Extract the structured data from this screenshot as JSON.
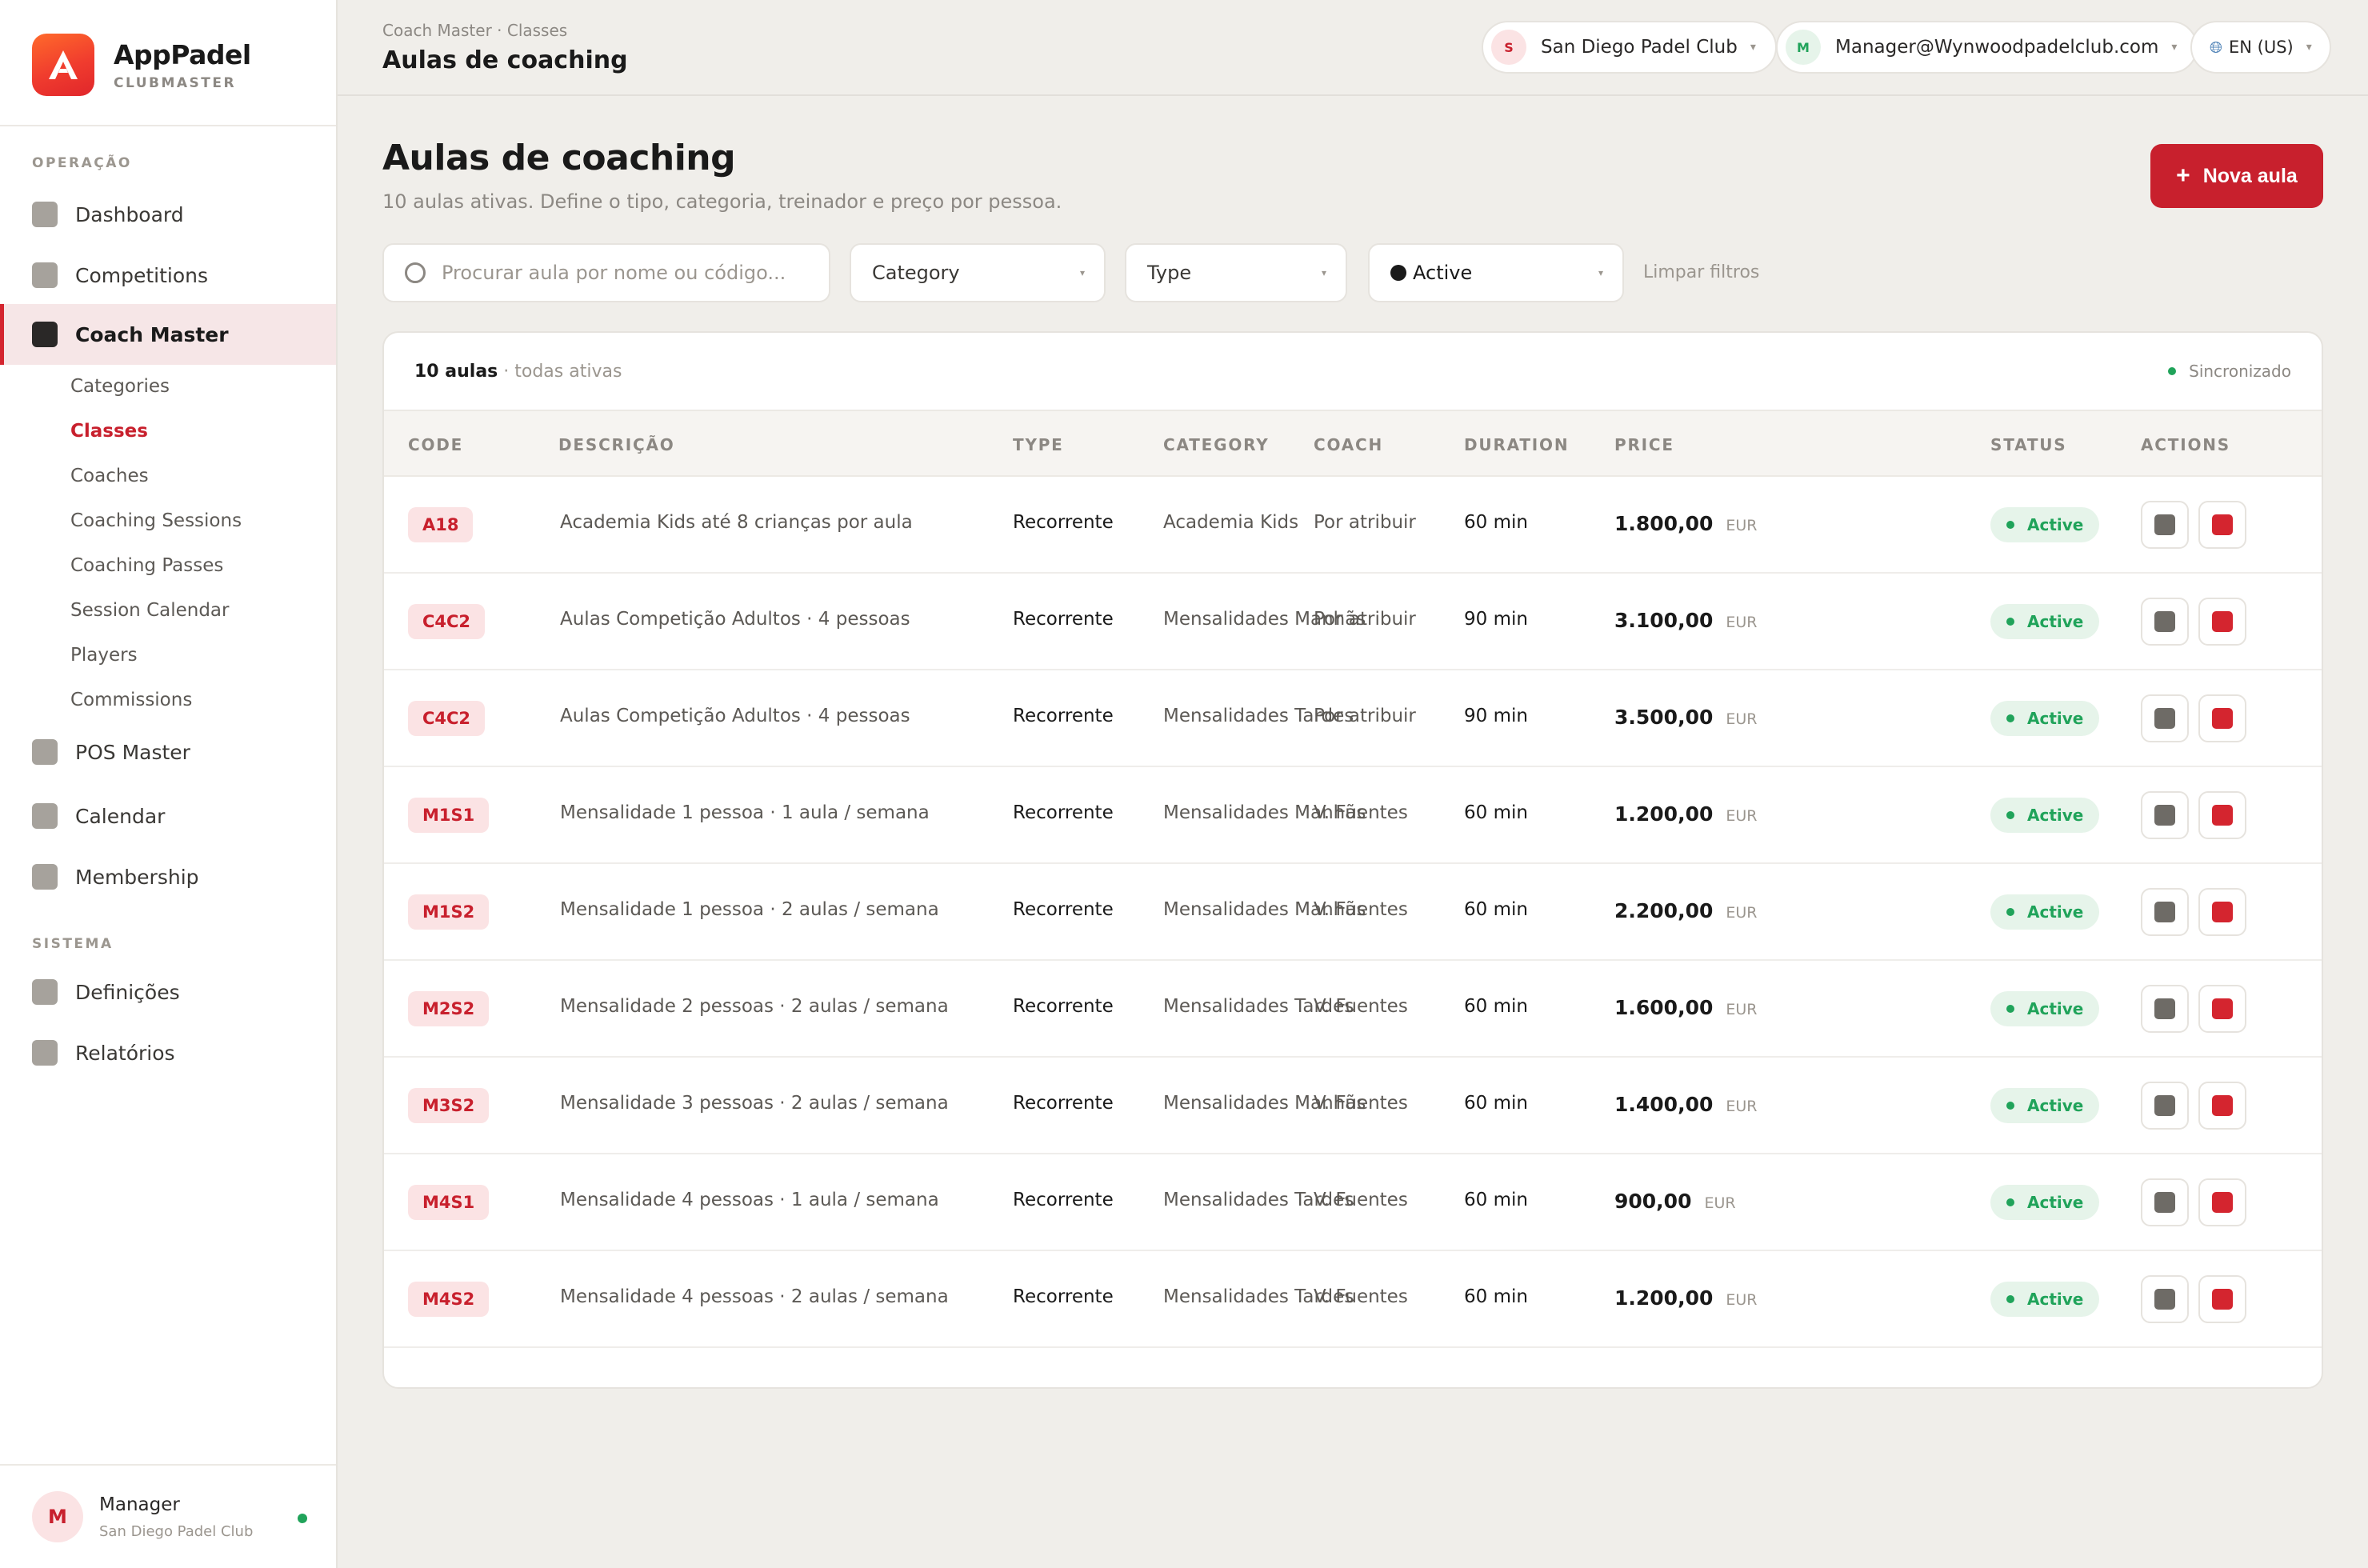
{
  "brand": {
    "name": "AppPadel",
    "sub": "CLUBMASTER"
  },
  "sidebar": {
    "section_operacao": "OPERAÇÃO",
    "section_sistema": "SISTEMA",
    "items": [
      {
        "label": "Dashboard"
      },
      {
        "label": "Competitions"
      },
      {
        "label": "Coach Master"
      },
      {
        "label": "POS Master"
      },
      {
        "label": "Calendar"
      },
      {
        "label": "Membership"
      },
      {
        "label": "Definições"
      },
      {
        "label": "Relatórios"
      }
    ],
    "sub_items": [
      {
        "label": "Categories"
      },
      {
        "label": "Classes"
      },
      {
        "label": "Coaches"
      },
      {
        "label": "Coaching Sessions"
      },
      {
        "label": "Coaching Passes"
      },
      {
        "label": "Session Calendar"
      },
      {
        "label": "Players"
      },
      {
        "label": "Commissions"
      }
    ],
    "footer": {
      "avatar": "M",
      "name": "Manager",
      "club": "San Diego Padel Club"
    }
  },
  "topbar": {
    "breadcrumb": "Coach Master · Classes",
    "title": "Aulas de coaching",
    "club_initial": "S",
    "club": "San Diego Padel Club",
    "user_initial": "M",
    "user": "Manager@Wynwoodpadelclub.com",
    "lang": "EN (US)"
  },
  "page": {
    "title": "Aulas de coaching",
    "subtitle": "10 aulas ativas. Define o tipo, categoria, treinador e preço por pessoa.",
    "new_button": "Nova aula"
  },
  "filters": {
    "search_placeholder": "Procurar aula por nome ou código...",
    "category": "Category",
    "type": "Type",
    "status": "Active",
    "clear": "Limpar filtros"
  },
  "table": {
    "count": "10 aulas",
    "count_sub": " · todas ativas",
    "sync": "Sincronizado",
    "headers": [
      "CODE",
      "DESCRIÇÃO",
      "TYPE",
      "CATEGORY",
      "COACH",
      "DURATION",
      "PRICE",
      "STATUS",
      "ACTIONS"
    ],
    "rows": [
      {
        "code": "A18",
        "desc": "Academia Kids até 8 crianças por aula",
        "type": "Recorrente",
        "category": "Academia Kids",
        "coach": "Por atribuir",
        "duration": "60 min",
        "price": "1.800,00",
        "currency": "EUR",
        "status": "Active"
      },
      {
        "code": "C4C2",
        "desc": "Aulas Competição Adultos · 4 pessoas",
        "type": "Recorrente",
        "category": "Mensalidades Manhãs",
        "coach": "Por atribuir",
        "duration": "90 min",
        "price": "3.100,00",
        "currency": "EUR",
        "status": "Active"
      },
      {
        "code": "C4C2",
        "desc": "Aulas Competição Adultos · 4 pessoas",
        "type": "Recorrente",
        "category": "Mensalidades Tardes",
        "coach": "Por atribuir",
        "duration": "90 min",
        "price": "3.500,00",
        "currency": "EUR",
        "status": "Active"
      },
      {
        "code": "M1S1",
        "desc": "Mensalidade 1 pessoa · 1 aula / semana",
        "type": "Recorrente",
        "category": "Mensalidades Manhãs",
        "coach": "V. Fuentes",
        "duration": "60 min",
        "price": "1.200,00",
        "currency": "EUR",
        "status": "Active"
      },
      {
        "code": "M1S2",
        "desc": "Mensalidade 1 pessoa · 2 aulas / semana",
        "type": "Recorrente",
        "category": "Mensalidades Manhãs",
        "coach": "V. Fuentes",
        "duration": "60 min",
        "price": "2.200,00",
        "currency": "EUR",
        "status": "Active"
      },
      {
        "code": "M2S2",
        "desc": "Mensalidade 2 pessoas · 2 aulas / semana",
        "type": "Recorrente",
        "category": "Mensalidades Tardes",
        "coach": "V. Fuentes",
        "duration": "60 min",
        "price": "1.600,00",
        "currency": "EUR",
        "status": "Active"
      },
      {
        "code": "M3S2",
        "desc": "Mensalidade 3 pessoas · 2 aulas / semana",
        "type": "Recorrente",
        "category": "Mensalidades Manhãs",
        "coach": "V. Fuentes",
        "duration": "60 min",
        "price": "1.400,00",
        "currency": "EUR",
        "status": "Active"
      },
      {
        "code": "M4S1",
        "desc": "Mensalidade 4 pessoas · 1 aula / semana",
        "type": "Recorrente",
        "category": "Mensalidades Tardes",
        "coach": "V. Fuentes",
        "duration": "60 min",
        "price": "900,00",
        "currency": "EUR",
        "status": "Active"
      },
      {
        "code": "M4S2",
        "desc": "Mensalidade 4 pessoas · 2 aulas / semana",
        "type": "Recorrente",
        "category": "Mensalidades Tardes",
        "coach": "V. Fuentes",
        "duration": "60 min",
        "price": "1.200,00",
        "currency": "EUR",
        "status": "Active"
      }
    ]
  },
  "colors": {
    "accent": "#c8202d",
    "status_active": "#20a35a",
    "background": "#f0eeea"
  }
}
